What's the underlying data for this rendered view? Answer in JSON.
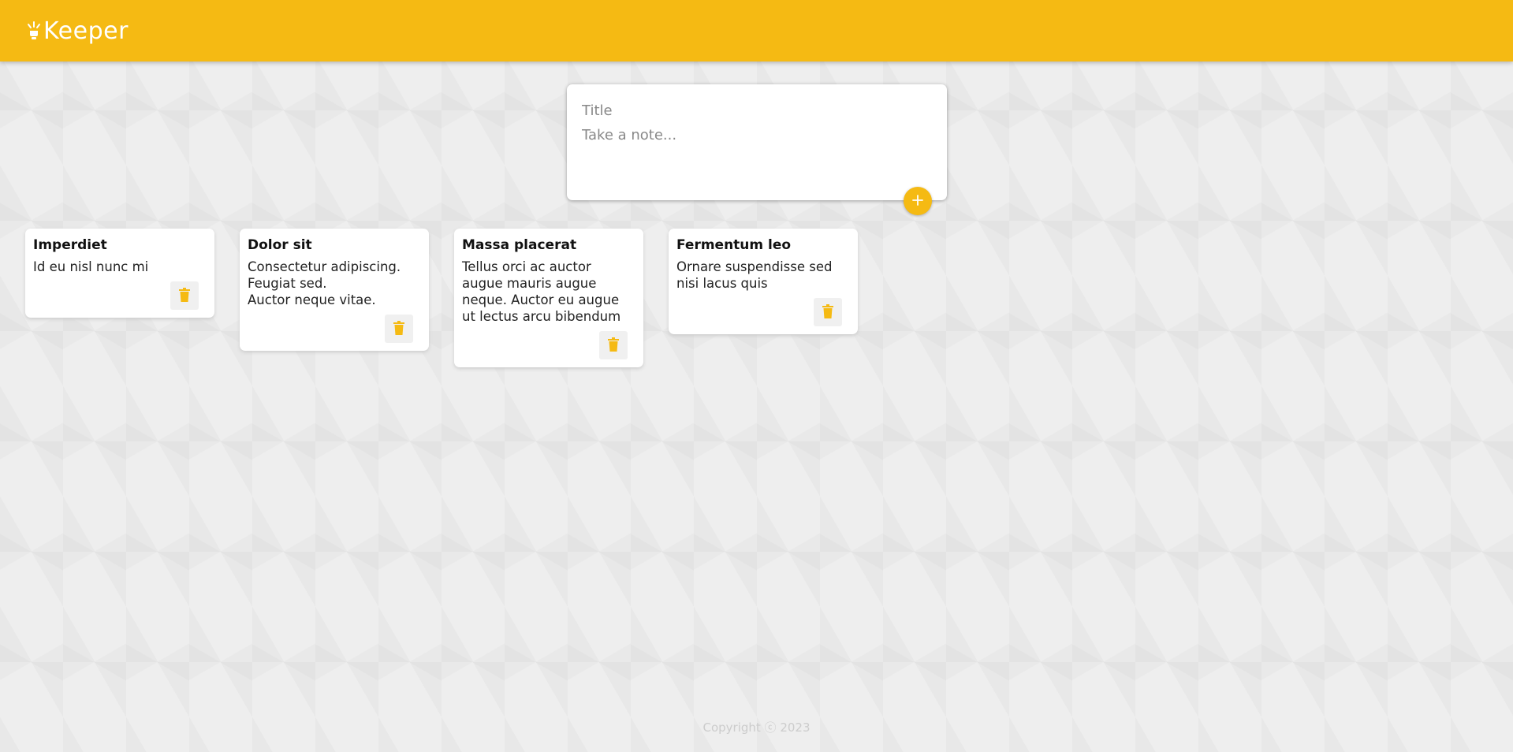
{
  "app": {
    "title": "Keeper",
    "accent_color": "#f5ba13",
    "logo_icon": "lightbulb-icon"
  },
  "create_note": {
    "title_placeholder": "Title",
    "content_placeholder": "Take a note...",
    "add_icon": "plus-icon"
  },
  "notes": [
    {
      "title": "Imperdiet",
      "content": "Id eu nisl nunc mi",
      "delete_icon": "trash-icon"
    },
    {
      "title": "Dolor sit",
      "content": "Consectetur adipiscing.\nFeugiat sed.\nAuctor neque vitae.",
      "delete_icon": "trash-icon"
    },
    {
      "title": "Massa placerat",
      "content": "Tellus orci ac auctor augue mauris augue neque. Auctor eu augue ut lectus arcu bibendum",
      "delete_icon": "trash-icon"
    },
    {
      "title": "Fermentum leo",
      "content": "Ornare suspendisse sed nisi lacus quis",
      "delete_icon": "trash-icon"
    }
  ],
  "footer": {
    "copyright": "Copyright ⓒ 2023"
  }
}
